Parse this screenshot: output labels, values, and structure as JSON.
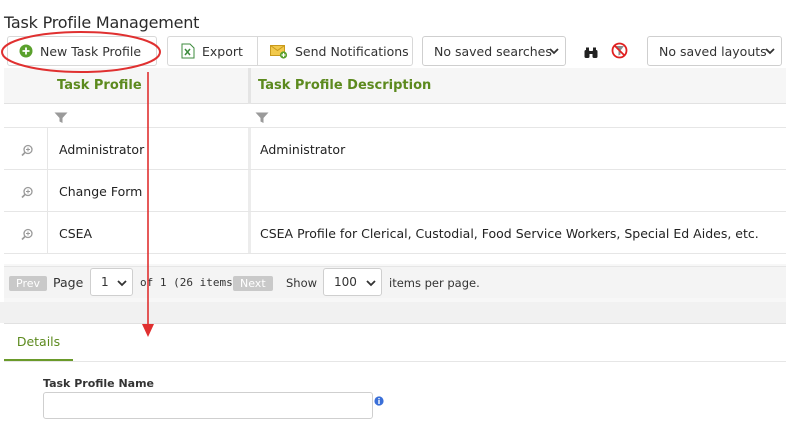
{
  "page": {
    "title": "Task Profile Management"
  },
  "toolbar": {
    "new_label": "New Task Profile",
    "export_label": "Export",
    "notify_label": "Send Notifications",
    "saved_searches": "No saved searches",
    "saved_layouts": "No saved layouts"
  },
  "grid": {
    "columns": [
      "Task Profile",
      "Task Profile Description"
    ],
    "rows": [
      {
        "name": "Administrator",
        "description": "Administrator"
      },
      {
        "name": "Change Form",
        "description": ""
      },
      {
        "name": "CSEA",
        "description": "CSEA Profile for Clerical, Custodial, Food Service Workers, Special Ed Aides, etc."
      }
    ]
  },
  "pager": {
    "prev_label": "Prev",
    "page_word": "Page",
    "page_value": "1",
    "of_text": "of 1 (26 items)",
    "next_label": "Next",
    "show_word": "Show",
    "per_page": "100",
    "per_page_suffix": "items per page."
  },
  "details": {
    "tab_label": "Details",
    "field_label": "Task Profile Name",
    "field_value": ""
  },
  "colors": {
    "accent_green": "#5c8a1e",
    "annotation_red": "#e03030"
  },
  "icons": [
    "add-circle-icon",
    "excel-icon",
    "mail-icon",
    "binoculars-icon",
    "clear-filter-icon",
    "filter-icon",
    "zoom-icon",
    "info-icon",
    "chevron-down-icon"
  ]
}
